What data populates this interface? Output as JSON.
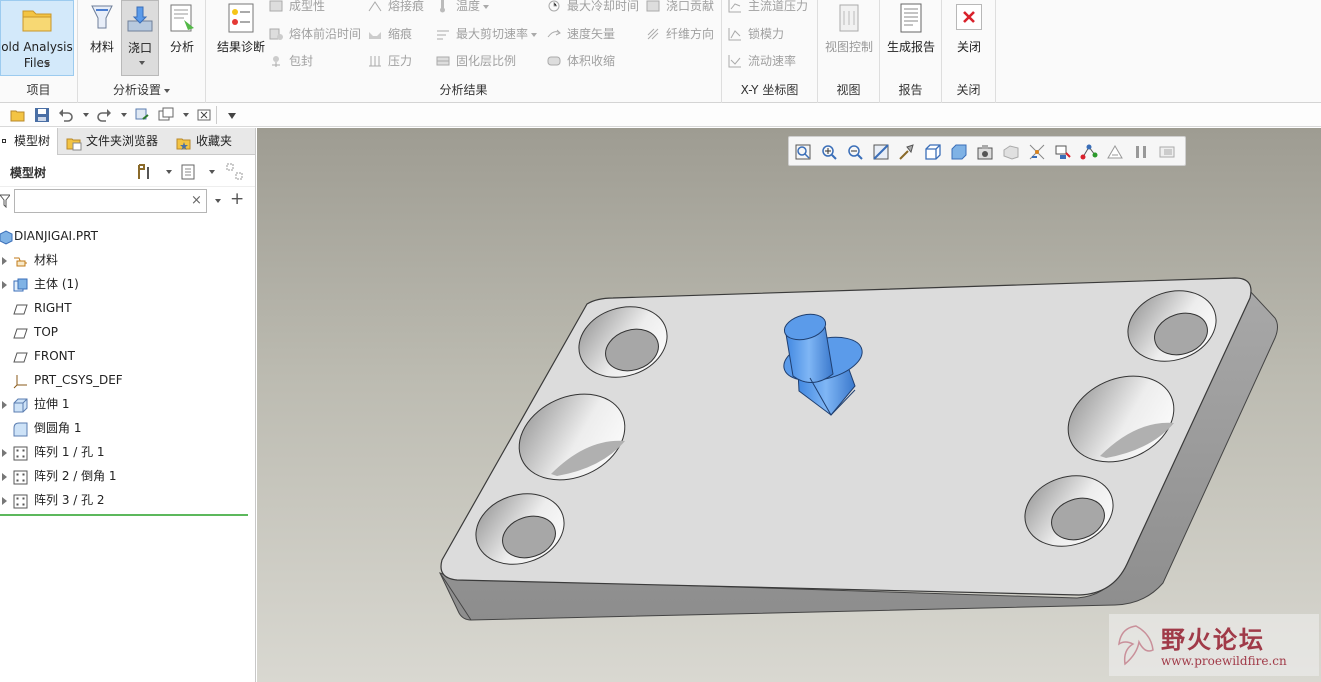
{
  "ribbon": {
    "project_group": {
      "label": "项目",
      "mold_analysis_files": "old Analysis\nFiles"
    },
    "analysis_setup_group": {
      "label": "分析设置",
      "material": "材料",
      "gate": "浇口",
      "analysis": "分析"
    },
    "analysis_results_group": {
      "label": "分析结果",
      "result_diagnosis": "结果诊断",
      "col1": [
        "成型性",
        "熔体前沿时间",
        "包封"
      ],
      "col2": [
        "熔接痕",
        "缩痕",
        "压力"
      ],
      "col3": [
        "温度",
        "最大剪切速率",
        "固化层比例"
      ],
      "col4": [
        "最大冷却时间",
        "速度矢量",
        "体积收缩"
      ],
      "col5": [
        "浇口贡献",
        "纤维方向"
      ]
    },
    "xy_group": {
      "label": "X-Y 坐标图",
      "items": [
        "主流道压力",
        "锁模力",
        "流动速率"
      ]
    },
    "view_group": {
      "label": "视图",
      "view_control": "视图控制"
    },
    "report_group": {
      "label": "报告",
      "generate_report": "生成报告"
    },
    "close_group": {
      "label": "关闭",
      "close": "关闭"
    }
  },
  "left_panel": {
    "tabs": [
      {
        "label": "模型树",
        "active": true
      },
      {
        "label": "文件夹浏览器",
        "active": false
      },
      {
        "label": "收藏夹",
        "active": false
      }
    ],
    "tree_title": "模型树",
    "filter_placeholder": "",
    "tree_items": [
      {
        "label": "DIANJIGAI.PRT",
        "root": true,
        "expandable": false,
        "icon": "part-icon"
      },
      {
        "label": "材料",
        "expandable": true,
        "icon": "material-icon"
      },
      {
        "label": "主体 (1)",
        "expandable": true,
        "icon": "body-icon"
      },
      {
        "label": "RIGHT",
        "expandable": false,
        "icon": "datum-plane-icon"
      },
      {
        "label": "TOP",
        "expandable": false,
        "icon": "datum-plane-icon"
      },
      {
        "label": "FRONT",
        "expandable": false,
        "icon": "datum-plane-icon"
      },
      {
        "label": "PRT_CSYS_DEF",
        "expandable": false,
        "icon": "csys-icon"
      },
      {
        "label": "拉伸 1",
        "expandable": true,
        "icon": "extrude-icon"
      },
      {
        "label": "倒圆角 1",
        "expandable": false,
        "icon": "round-icon"
      },
      {
        "label": "阵列 1 / 孔 1",
        "expandable": true,
        "icon": "pattern-icon"
      },
      {
        "label": "阵列 2 / 倒角 1",
        "expandable": true,
        "icon": "pattern-icon"
      },
      {
        "label": "阵列 3 / 孔 2",
        "expandable": true,
        "icon": "pattern-icon"
      }
    ]
  },
  "watermark": {
    "title": "野火论坛",
    "url": "www.proewildfire.cn"
  },
  "colors": {
    "part_face": "#dcdcdc",
    "gate_blue": "#5b9bea",
    "close_red": "#d9212b",
    "watermark": "#a03a48"
  }
}
